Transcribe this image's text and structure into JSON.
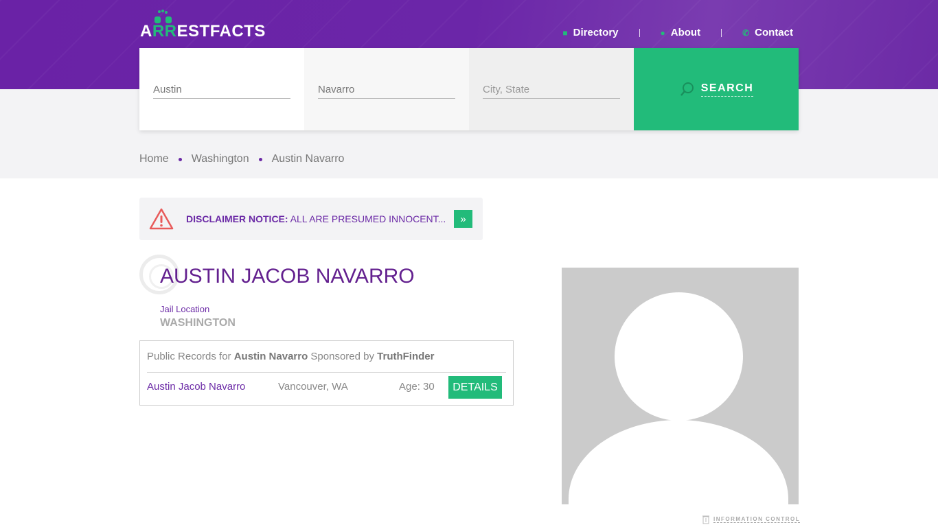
{
  "header": {
    "logo": {
      "a": "A",
      "rr": "RR",
      "rest": "ESTFACTS"
    },
    "nav": [
      {
        "label": "Directory",
        "icon": "folder-icon"
      },
      {
        "label": "About",
        "icon": "info-icon"
      },
      {
        "label": "Contact",
        "icon": "phone-icon"
      }
    ]
  },
  "search": {
    "first_name": "Austin",
    "last_name": "Navarro",
    "location_placeholder": "City, State",
    "button": "SEARCH"
  },
  "breadcrumb": [
    "Home",
    "Washington",
    "Austin Navarro"
  ],
  "disclaimer": {
    "title": "DISCLAIMER NOTICE:",
    "text": " ALL ARE PRESUMED INNOCENT..."
  },
  "profile": {
    "name": "AUSTIN JACOB NAVARRO",
    "jail_label": "Jail Location",
    "jail_value": "WASHINGTON"
  },
  "records": {
    "prefix": "Public Records for ",
    "name": "Austin Navarro",
    "mid": " Sponsored by ",
    "sponsor": "TruthFinder",
    "row": {
      "name": "Austin Jacob Navarro",
      "location": "Vancouver, WA",
      "age": "Age: 30",
      "button": "DETAILS"
    }
  },
  "footer": {
    "info_control": "INFORMATION CONTROL"
  },
  "colors": {
    "purple": "#6b2aa6",
    "green": "#22bb7a"
  }
}
